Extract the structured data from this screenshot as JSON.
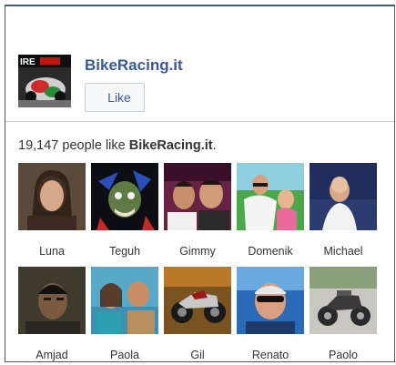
{
  "page": {
    "name": "BikeRacing.it",
    "like_button": "Like",
    "count_number": "19,147",
    "count_text": " people like ",
    "count_suffix": "."
  },
  "fans": [
    {
      "name": "Luna"
    },
    {
      "name": "Teguh"
    },
    {
      "name": "Gimmy"
    },
    {
      "name": "Domenik"
    },
    {
      "name": "Michael"
    },
    {
      "name": "Amjad"
    },
    {
      "name": "Paola"
    },
    {
      "name": "Gil"
    },
    {
      "name": "Renato"
    },
    {
      "name": "Paolo"
    }
  ],
  "colors": {
    "facebook_blue": "#3b5998",
    "border": "#315c99"
  }
}
